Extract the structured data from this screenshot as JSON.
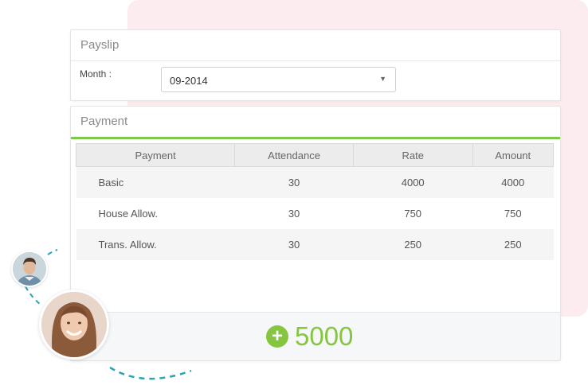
{
  "payslip": {
    "title": "Payslip",
    "month_label": "Month :",
    "month_value": "09-2014"
  },
  "payment": {
    "title": "Payment",
    "columns": [
      "Payment",
      "Attendance",
      "Rate",
      "Amount"
    ],
    "rows": [
      {
        "name": "Basic",
        "attendance": "30",
        "rate": "4000",
        "amount": "4000"
      },
      {
        "name": "House Allow.",
        "attendance": "30",
        "rate": "750",
        "amount": "750"
      },
      {
        "name": "Trans. Allow.",
        "attendance": "30",
        "rate": "250",
        "amount": "250"
      }
    ],
    "total": "5000"
  },
  "icons": {
    "dropdown": "chevron-down-icon",
    "total": "plus-circle-icon"
  },
  "colors": {
    "accent_green": "#86c540",
    "header_underline": "#7dc94e",
    "pink_backdrop": "#fdecef",
    "dash_teal": "#2aa6b0"
  }
}
